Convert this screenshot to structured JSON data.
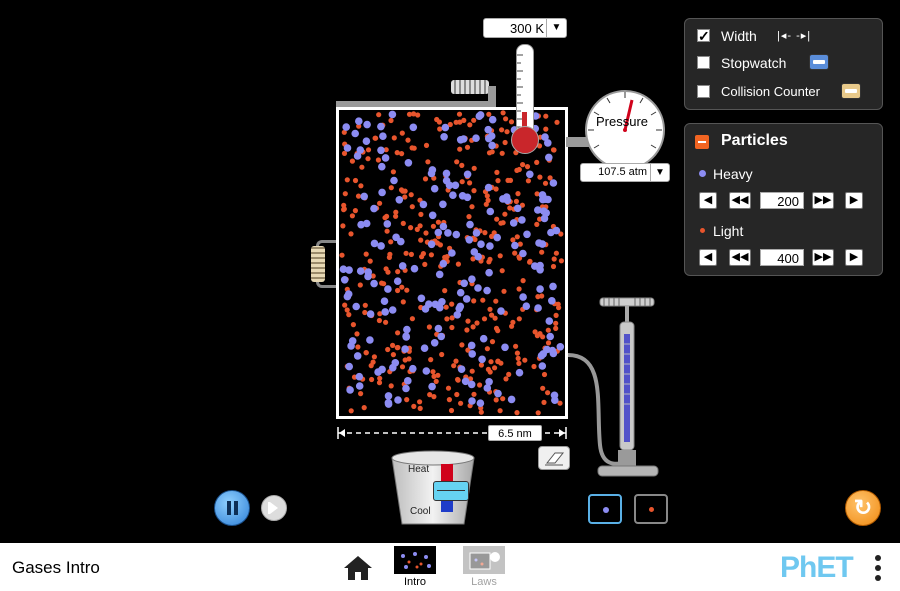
{
  "thermometer": {
    "temperature": "300 K"
  },
  "gauge": {
    "label": "Pressure",
    "reading": "107.5 atm"
  },
  "container": {
    "width_label": "6.5 nm"
  },
  "heater": {
    "heat_label": "Heat",
    "cool_label": "Cool"
  },
  "options_panel": {
    "width_label": "Width",
    "width_checked": true,
    "stopwatch_label": "Stopwatch",
    "stopwatch_checked": false,
    "collision_label": "Collision Counter",
    "collision_checked": false
  },
  "particles_panel": {
    "title": "Particles",
    "heavy": {
      "label": "Heavy",
      "count": "200"
    },
    "light": {
      "label": "Light",
      "count": "400"
    }
  },
  "colors": {
    "heavy_particle": "#8c8cf2",
    "light_particle": "#e8552d",
    "reset_button": "#f08a12",
    "accent_blue": "#5ab0e6"
  },
  "navbar": {
    "sim_title": "Gases Intro",
    "screens": [
      {
        "label": "Intro",
        "selected": true
      },
      {
        "label": "Laws",
        "selected": false
      }
    ],
    "logo": "PhET"
  },
  "icons": [
    "home-icon",
    "kebab-menu-icon",
    "eraser-icon",
    "reset-icon",
    "pause-icon",
    "step-icon",
    "pump-icon",
    "thermometer-icon"
  ]
}
